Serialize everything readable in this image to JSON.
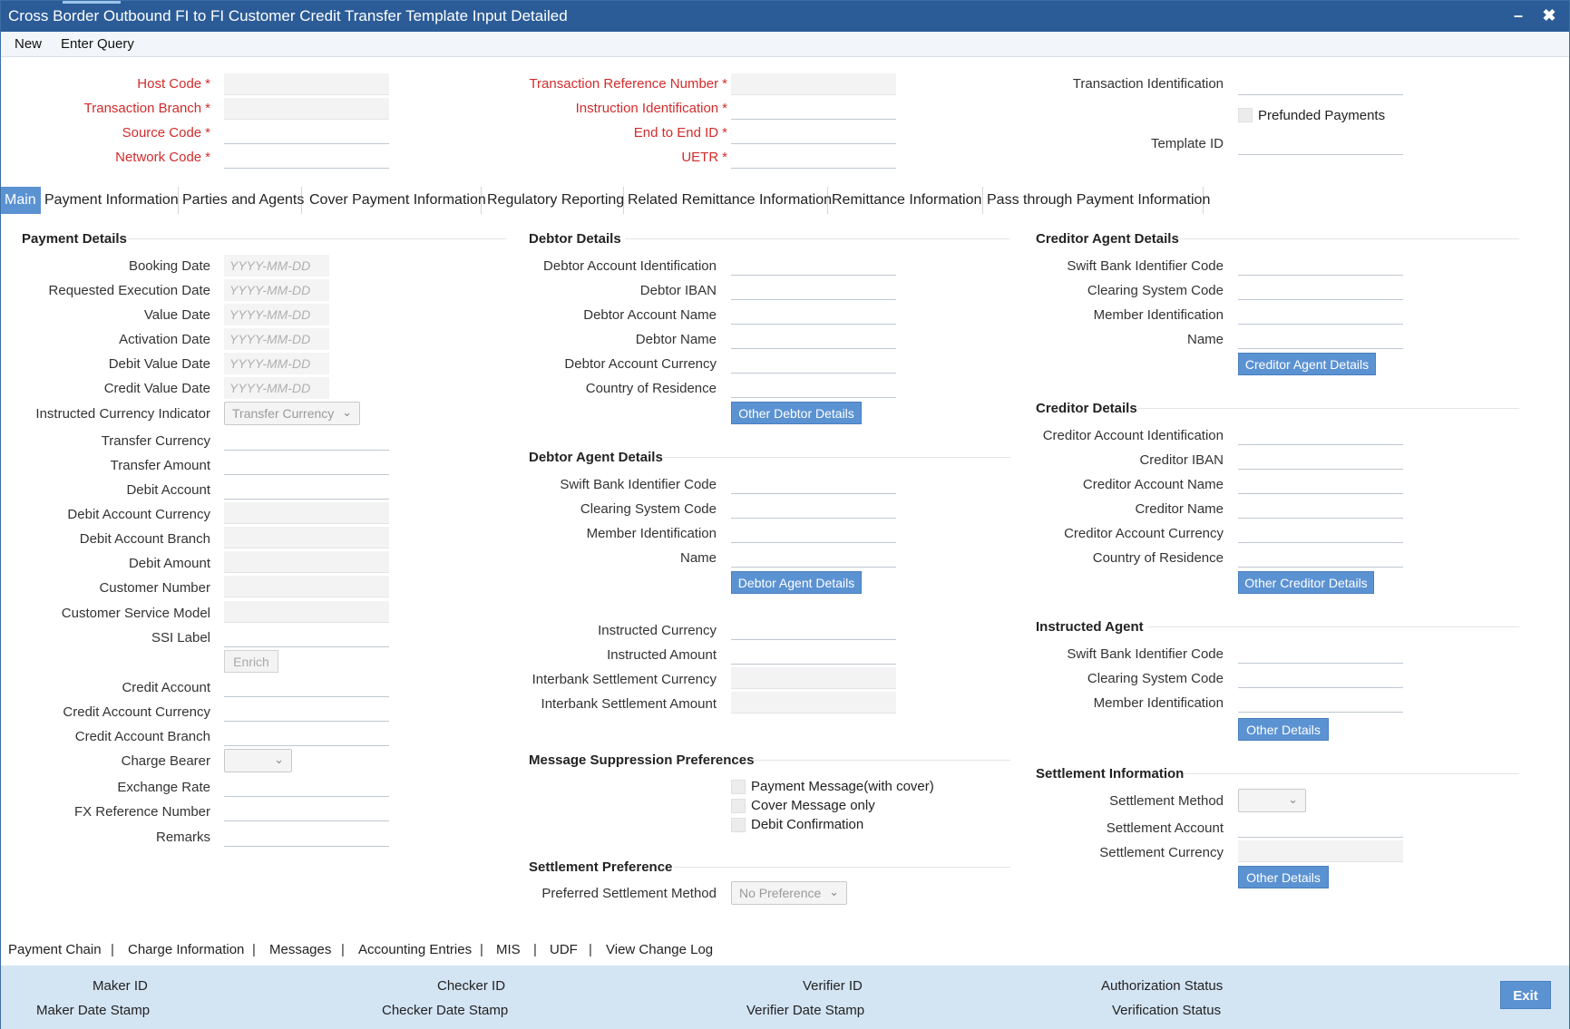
{
  "window": {
    "title": "Cross Border Outbound FI to FI Customer Credit Transfer Template Input Detailed",
    "minimize_glyph": "–",
    "close_glyph": "✖"
  },
  "menu": {
    "new": "New",
    "enter_query": "Enter Query"
  },
  "header": {
    "host_code": "Host Code",
    "transaction_branch": "Transaction Branch",
    "source_code": "Source Code",
    "network_code": "Network Code",
    "transaction_reference_number": "Transaction Reference Number",
    "instruction_identification": "Instruction Identification",
    "end_to_end_id": "End to End ID",
    "uetr": "UETR",
    "transaction_identification": "Transaction Identification",
    "prefunded_payments": "Prefunded Payments",
    "template_id": "Template ID",
    "required_mark": "*"
  },
  "tabs": [
    "Main",
    "Payment Information",
    "Parties and Agents",
    "Cover Payment Information",
    "Regulatory Reporting",
    "Related Remittance Information",
    "Remittance Information",
    "Pass through Payment Information"
  ],
  "payment_details": {
    "title": "Payment Details",
    "booking_date": "Booking Date",
    "requested_execution_date": "Requested Execution Date",
    "value_date": "Value Date",
    "activation_date": "Activation Date",
    "debit_value_date": "Debit Value Date",
    "credit_value_date": "Credit Value Date",
    "date_placeholder": "YYYY-MM-DD",
    "instructed_currency_indicator": "Instructed Currency Indicator",
    "instructed_currency_indicator_value": "Transfer Currency",
    "transfer_currency": "Transfer Currency",
    "transfer_amount": "Transfer Amount",
    "debit_account": "Debit Account",
    "debit_account_currency": "Debit Account Currency",
    "debit_account_branch": "Debit Account Branch",
    "debit_amount": "Debit Amount",
    "customer_number": "Customer Number",
    "customer_service_model": "Customer Service Model",
    "ssi_label": "SSI Label",
    "enrich": "Enrich",
    "credit_account": "Credit Account",
    "credit_account_currency": "Credit Account Currency",
    "credit_account_branch": "Credit Account Branch",
    "charge_bearer": "Charge Bearer",
    "exchange_rate": "Exchange Rate",
    "fx_reference_number": "FX Reference Number",
    "remarks": "Remarks"
  },
  "debtor_details": {
    "title": "Debtor Details",
    "account_identification": "Debtor Account Identification",
    "iban": "Debtor IBAN",
    "account_name": "Debtor Account Name",
    "name": "Debtor Name",
    "account_currency": "Debtor Account Currency",
    "country_of_residence": "Country of Residence",
    "other_button": "Other Debtor Details"
  },
  "debtor_agent": {
    "title": "Debtor Agent Details",
    "swift_bic": "Swift Bank Identifier Code",
    "clearing_system_code": "Clearing System Code",
    "member_identification": "Member Identification",
    "name": "Name",
    "button": "Debtor Agent Details"
  },
  "amounts": {
    "instructed_currency": "Instructed Currency",
    "instructed_amount": "Instructed Amount",
    "interbank_settlement_currency": "Interbank Settlement Currency",
    "interbank_settlement_amount": "Interbank Settlement Amount"
  },
  "message_suppression": {
    "title": "Message Suppression Preferences",
    "payment_message": "Payment Message(with cover)",
    "cover_message": "Cover Message only",
    "debit_confirmation": "Debit Confirmation"
  },
  "settlement_preference": {
    "title": "Settlement Preference",
    "preferred_method": "Preferred Settlement Method",
    "preferred_method_value": "No Preference"
  },
  "creditor_agent": {
    "title": "Creditor Agent Details",
    "swift_bic": "Swift Bank Identifier Code",
    "clearing_system_code": "Clearing System Code",
    "member_identification": "Member Identification",
    "name": "Name",
    "button": "Creditor Agent Details"
  },
  "creditor_details": {
    "title": "Creditor Details",
    "account_identification": "Creditor Account Identification",
    "iban": "Creditor IBAN",
    "account_name": "Creditor Account Name",
    "name": "Creditor Name",
    "account_currency": "Creditor Account Currency",
    "country_of_residence": "Country of Residence",
    "other_button": "Other Creditor Details"
  },
  "instructed_agent": {
    "title": "Instructed Agent",
    "swift_bic": "Swift Bank Identifier Code",
    "clearing_system_code": "Clearing System Code",
    "member_identification": "Member Identification",
    "button": "Other Details"
  },
  "settlement_information": {
    "title": "Settlement Information",
    "method": "Settlement Method",
    "account": "Settlement Account",
    "currency": "Settlement Currency",
    "button": "Other Details"
  },
  "bottom_links": [
    "Payment Chain",
    "Charge Information",
    "Messages",
    "Accounting Entries",
    "MIS",
    "UDF",
    "View Change Log"
  ],
  "bottom_separator": "|",
  "footer": {
    "maker_id": "Maker ID",
    "maker_date_stamp": "Maker Date Stamp",
    "checker_id": "Checker ID",
    "checker_date_stamp": "Checker Date Stamp",
    "verifier_id": "Verifier ID",
    "verifier_date_stamp": "Verifier Date Stamp",
    "authorization_status": "Authorization Status",
    "verification_status": "Verification Status",
    "exit": "Exit"
  },
  "icons": {
    "chevron": "chevron-down-icon"
  },
  "colors": {
    "title_bar": "#2b5c97",
    "accent_button": "#5b92d2",
    "required": "#d22c2c",
    "footer": "#d3e4f3"
  }
}
